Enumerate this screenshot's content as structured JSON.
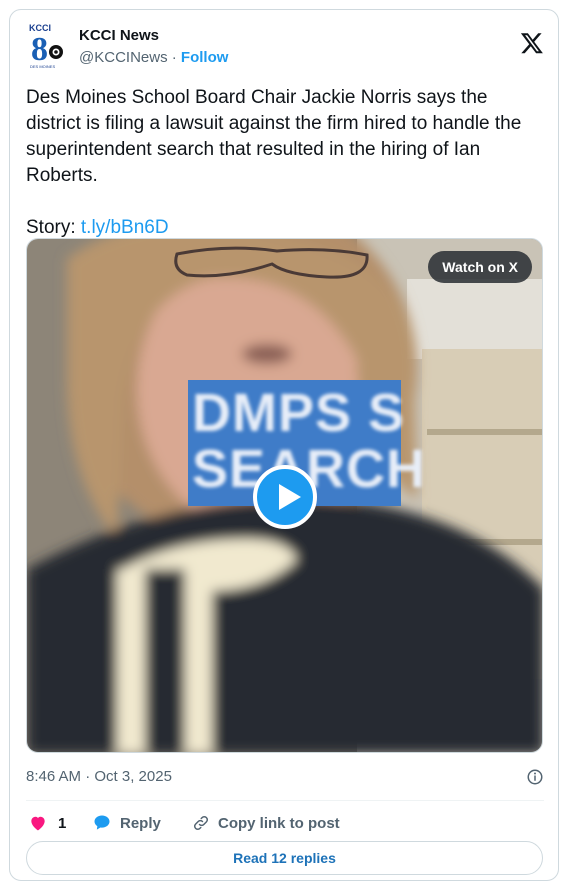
{
  "account": {
    "name": "KCCI News",
    "handle": "@KCCINews",
    "separator": "·",
    "follow_label": "Follow",
    "avatar_text_top": "KCCI",
    "avatar_number": "8",
    "avatar_text_bottom": "DES MOINES"
  },
  "tweet": {
    "text": "Des Moines School Board Chair Jackie Norris says the district is filing a lawsuit against the firm hired to handle the superintendent search that resulted in the hiring of Ian Roberts.",
    "story_label": "Story:",
    "story_link": "t.ly/bBn6D"
  },
  "media": {
    "watch_label": "Watch on X",
    "overlay_line1": "DMPS S",
    "overlay_line2": "SEARCH",
    "overlay_color": "#3f7cc8"
  },
  "meta": {
    "timestamp": "8:46 AM · Oct 3, 2025"
  },
  "actions": {
    "like_count": "1",
    "reply_label": "Reply",
    "copy_label": "Copy link to post"
  },
  "footer": {
    "read_replies_label": "Read 12 replies"
  },
  "colors": {
    "accent": "#1d9bf0",
    "like": "#f91880",
    "muted": "#536471",
    "text": "#0f1419"
  },
  "icons": [
    "x-logo-icon",
    "play-icon",
    "info-icon",
    "heart-icon",
    "reply-bubble-icon",
    "link-icon"
  ]
}
